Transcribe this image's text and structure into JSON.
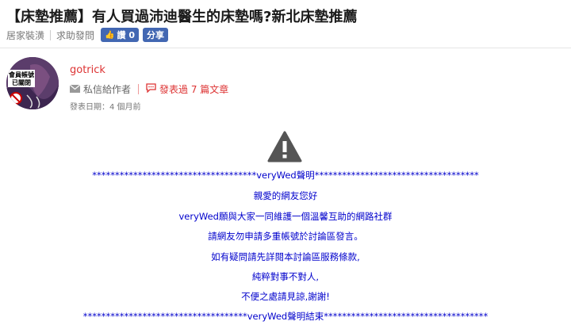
{
  "post": {
    "title": "【床墊推薦】有人買過沛迪醫生的床墊嗎?新北床墊推薦",
    "category": "居家裝潢",
    "subcategory": "求助發問",
    "like_label": "讚 0",
    "share_label": "分享"
  },
  "author": {
    "name": "gotrick",
    "message_label": "私信給作者",
    "posts_label": "發表過 7 篇文章",
    "date_label": "發表日期：4 個月前",
    "avatar_text": "會員帳號已關閉"
  },
  "notice": {
    "line1": "************************************veryWed聲明************************************",
    "line2": "親愛的網友您好",
    "line3": "veryWed願與大家一同維護一個溫馨互助的網路社群",
    "line4": "請網友勿申請多重帳號於討論區發言。",
    "line5": "如有疑問請先詳閱本討論區服務條款,",
    "line6": "純粹對事不對人,",
    "line7": "不便之處請見諒,謝謝!",
    "line8": "************************************veryWed聲明結束************************************"
  },
  "colors": {
    "accent_red": "#dd3333",
    "notice_blue": "#0000cc",
    "facebook_blue": "#4267b2"
  }
}
